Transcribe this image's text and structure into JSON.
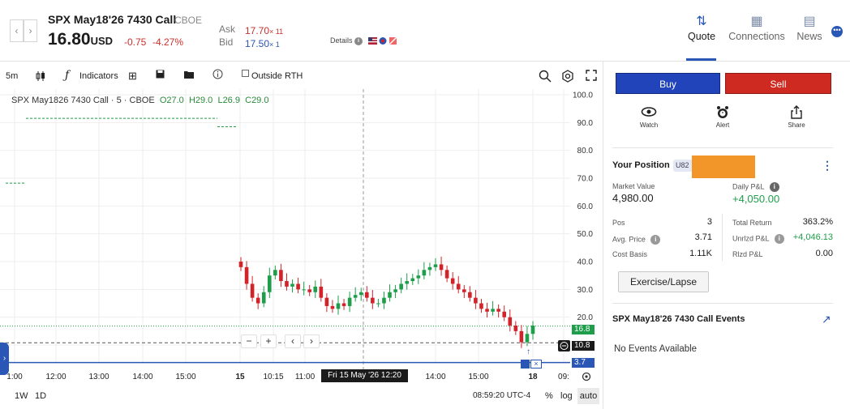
{
  "header": {
    "title": "SPX May18'26 7430 Call",
    "exchange": "CBOE",
    "price": "16.80",
    "currency": "USD",
    "change": "-0.75",
    "change_pct": "-4.27%",
    "ask_label": "Ask",
    "ask_price": "17.70",
    "ask_size": "× 11",
    "bid_label": "Bid",
    "bid_price": "17.50",
    "bid_size": "× 1",
    "details_label": "Details",
    "nav_prev": "‹",
    "nav_next": "›",
    "tabs": [
      {
        "label": "Quote",
        "icon": "sort-arrows-icon"
      },
      {
        "label": "Connections",
        "icon": "grid-icon"
      },
      {
        "label": "News",
        "icon": "newspaper-icon"
      }
    ],
    "more": "•••"
  },
  "toolbar": {
    "interval": "5m",
    "indicators": "Indicators",
    "outside_rth": "Outside RTH"
  },
  "chart": {
    "legend_title": "SPX May1826 7430 Call · 5 · CBOE",
    "legend_o_label": "O",
    "legend_o": "27.0",
    "legend_h_label": "H",
    "legend_h": "29.0",
    "legend_l_label": "L",
    "legend_l": "26.9",
    "legend_c_label": "C",
    "legend_c": "29.0",
    "crosshair_label": "Fri 15 May '26   12:20",
    "last_price_tag": "16.8",
    "cursor_price_tag": "10.8",
    "low_tag": "3.7",
    "colors": {
      "up": "#1e9e4a",
      "down": "#d2232a",
      "grid": "#eeeeee"
    }
  },
  "chart_data": {
    "type": "candlestick",
    "y_ticks": [
      "100.0",
      "90.0",
      "80.0",
      "70.0",
      "60.0",
      "50.0",
      "40.0",
      "30.0",
      "20.0",
      "10.0"
    ],
    "x_ticks": [
      "1:00",
      "12:00",
      "13:00",
      "14:00",
      "15:00",
      "15",
      "10:15",
      "11:00",
      "14:00",
      "15:00",
      "18",
      "09:"
    ],
    "ylim": [
      0,
      100
    ],
    "close_series": [
      38,
      32,
      27,
      25,
      29,
      35,
      37,
      33,
      31,
      32,
      30,
      30,
      29,
      31,
      27,
      24,
      23,
      25,
      24,
      27,
      28,
      29,
      27,
      25,
      25,
      27,
      29,
      30,
      32,
      33,
      34,
      35,
      37,
      38,
      39,
      37,
      34,
      32,
      30,
      29,
      27,
      25,
      23,
      22,
      23,
      22,
      20,
      17,
      15,
      11,
      14,
      17
    ]
  },
  "bottom": {
    "range_1w": "1W",
    "range_1d": "1D",
    "time": "08:59:20 UTC-4",
    "pct": "%",
    "log": "log",
    "auto": "auto"
  },
  "order": {
    "buy": "Buy",
    "sell": "Sell",
    "watch": "Watch",
    "alert": "Alert",
    "share": "Share"
  },
  "position": {
    "title": "Your Position",
    "account": "U82",
    "market_value_label": "Market Value",
    "market_value": "4,980.00",
    "daily_pnl_label": "Daily P&L",
    "daily_pnl": "+4,050.00",
    "pos_label": "Pos",
    "pos": "3",
    "avg_price_label": "Avg. Price",
    "avg_price": "3.71",
    "cost_basis_label": "Cost Basis",
    "cost_basis": "1.11K",
    "total_return_label": "Total Return",
    "total_return": "363.2%",
    "unrlzd_label": "Unrlzd P&L",
    "unrlzd": "+4,046.13",
    "rlzd_label": "Rlzd P&L",
    "rlzd": "0.00",
    "exercise_button": "Exercise/Lapse"
  },
  "events": {
    "title": "SPX May18'26 7430 Call Events",
    "empty": "No Events Available"
  }
}
